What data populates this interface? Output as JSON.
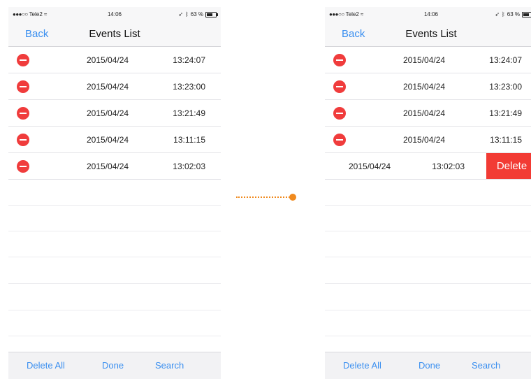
{
  "status_bar": {
    "carrier": "Tele2",
    "time": "14:06",
    "battery": "63 %"
  },
  "nav": {
    "back_label": "Back",
    "title": "Events List"
  },
  "events": [
    {
      "date": "2015/04/24",
      "time": "13:24:07"
    },
    {
      "date": "2015/04/24",
      "time": "13:23:00"
    },
    {
      "date": "2015/04/24",
      "time": "13:21:49"
    },
    {
      "date": "2015/04/24",
      "time": "13:11:15"
    },
    {
      "date": "2015/04/24",
      "time": "13:02:03"
    }
  ],
  "delete_label": "Delete",
  "toolbar": {
    "delete_all": "Delete All",
    "done": "Done",
    "search": "Search"
  },
  "colors": {
    "accent": "#3a8ff0",
    "delete": "#f23b34",
    "connector": "#f08a1e"
  },
  "icons": {
    "row_delete": "minus-circle-icon",
    "wifi": "wifi-icon",
    "bluetooth": "bluetooth-icon",
    "location": "location-arrow-icon",
    "battery": "battery-icon"
  }
}
